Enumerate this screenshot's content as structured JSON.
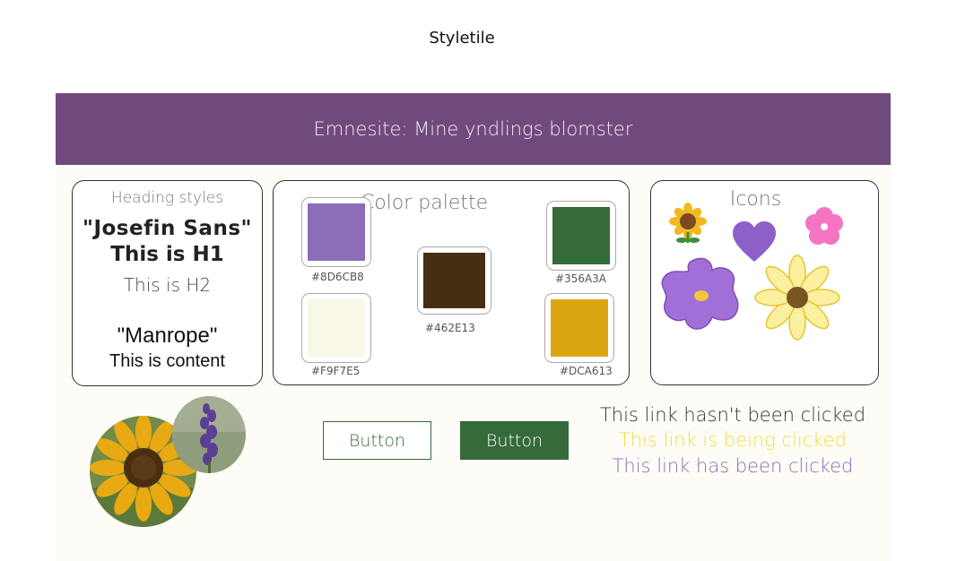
{
  "page": {
    "title": "Styletile"
  },
  "banner": {
    "text": "Emnesite: Mine yndlings blomster"
  },
  "heading_styles": {
    "title": "Heading styles",
    "heading_font": "\"Josefin Sans\"",
    "h1": "This is H1",
    "h2": "This is H2",
    "content_font": "\"Manrope\"",
    "content": "This is content"
  },
  "palette": {
    "title": "Color palette",
    "colors": [
      {
        "hex": "#8D6CB8",
        "label": "#8D6CB8"
      },
      {
        "hex": "#F9F7E5",
        "label": "#F9F7E5"
      },
      {
        "hex": "#462E13",
        "label": "#462E13"
      },
      {
        "hex": "#356A3A",
        "label": "#356A3A"
      },
      {
        "hex": "#DCA613",
        "label": "#DCA613"
      }
    ]
  },
  "icons": {
    "title": "Icons",
    "items": [
      "sunflower-icon",
      "heart-icon",
      "pink-flower-icon",
      "purple-flower-icon",
      "yellow-flower-icon"
    ]
  },
  "buttons": {
    "outline_label": "Button",
    "filled_label": "Button"
  },
  "links": {
    "unvisited": "This link hasn't been clicked",
    "active": "This link is being clicked",
    "visited": "This link has been clicked"
  },
  "images": [
    "sunflower-photo",
    "lavender-photo"
  ]
}
